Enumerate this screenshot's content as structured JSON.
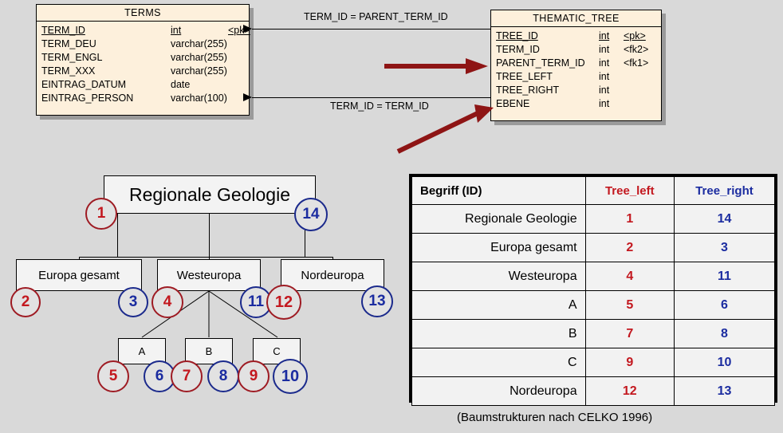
{
  "er": {
    "terms": {
      "title": "TERMS",
      "attributes": [
        {
          "name": "TERM_ID",
          "type": "int",
          "key": "<pk>",
          "pk": true
        },
        {
          "name": "TERM_DEU",
          "type": "varchar(255)",
          "key": "",
          "pk": false
        },
        {
          "name": "TERM_ENGL",
          "type": "varchar(255)",
          "key": "",
          "pk": false
        },
        {
          "name": "TERM_XXX",
          "type": "varchar(255)",
          "key": "",
          "pk": false
        },
        {
          "name": "EINTRAG_DATUM",
          "type": "date",
          "key": "",
          "pk": false
        },
        {
          "name": "EINTRAG_PERSON",
          "type": "varchar(100)",
          "key": "",
          "pk": false
        }
      ]
    },
    "thematic_tree": {
      "title": "THEMATIC_TREE",
      "attributes": [
        {
          "name": "TREE_ID",
          "type": "int",
          "key": "<pk>",
          "pk": true
        },
        {
          "name": "TERM_ID",
          "type": "int",
          "key": "<fk2>",
          "pk": false
        },
        {
          "name": "PARENT_TERM_ID",
          "type": "int",
          "key": "<fk1>",
          "pk": false
        },
        {
          "name": "TREE_LEFT",
          "type": "int",
          "key": "",
          "pk": false
        },
        {
          "name": "TREE_RIGHT",
          "type": "int",
          "key": "",
          "pk": false
        },
        {
          "name": "EBENE",
          "type": "int",
          "key": "",
          "pk": false
        }
      ]
    },
    "relationships": [
      {
        "label": "TERM_ID = PARENT_TERM_ID"
      },
      {
        "label": "TERM_ID = TERM_ID"
      }
    ]
  },
  "tree": {
    "root": {
      "label": "Regionale Geologie",
      "left": "1",
      "right": "14"
    },
    "level2": [
      {
        "label": "Europa gesamt",
        "left": "2",
        "right": "3"
      },
      {
        "label": "Westeuropa",
        "left": "4",
        "right": "11"
      },
      {
        "label": "Nordeuropa",
        "left": "12",
        "right": "13"
      }
    ],
    "leaves": [
      {
        "label": "A",
        "left": "5",
        "right": "6"
      },
      {
        "label": "B",
        "left": "7",
        "right": "8"
      },
      {
        "label": "C",
        "left": "9",
        "right": "10"
      }
    ]
  },
  "table": {
    "headers": [
      "Begriff (ID)",
      "Tree_left",
      "Tree_right"
    ],
    "rows": [
      {
        "term": "Regionale Geologie",
        "left": "1",
        "right": "14"
      },
      {
        "term": "Europa gesamt",
        "left": "2",
        "right": "3"
      },
      {
        "term": "Westeuropa",
        "left": "4",
        "right": "11"
      },
      {
        "term": "A",
        "left": "5",
        "right": "6"
      },
      {
        "term": "B",
        "left": "7",
        "right": "8"
      },
      {
        "term": "C",
        "left": "9",
        "right": "10"
      },
      {
        "term": "Nordeuropa",
        "left": "12",
        "right": "13"
      }
    ]
  },
  "caption": "(Baumstrukturen nach CELKO 1996)",
  "colors": {
    "background": "#d9d9d9",
    "entity_fill": "#fdf0dc",
    "tree_left": "#c3181f",
    "tree_right": "#1b2ca0",
    "red_arrow": "#8e1515"
  }
}
